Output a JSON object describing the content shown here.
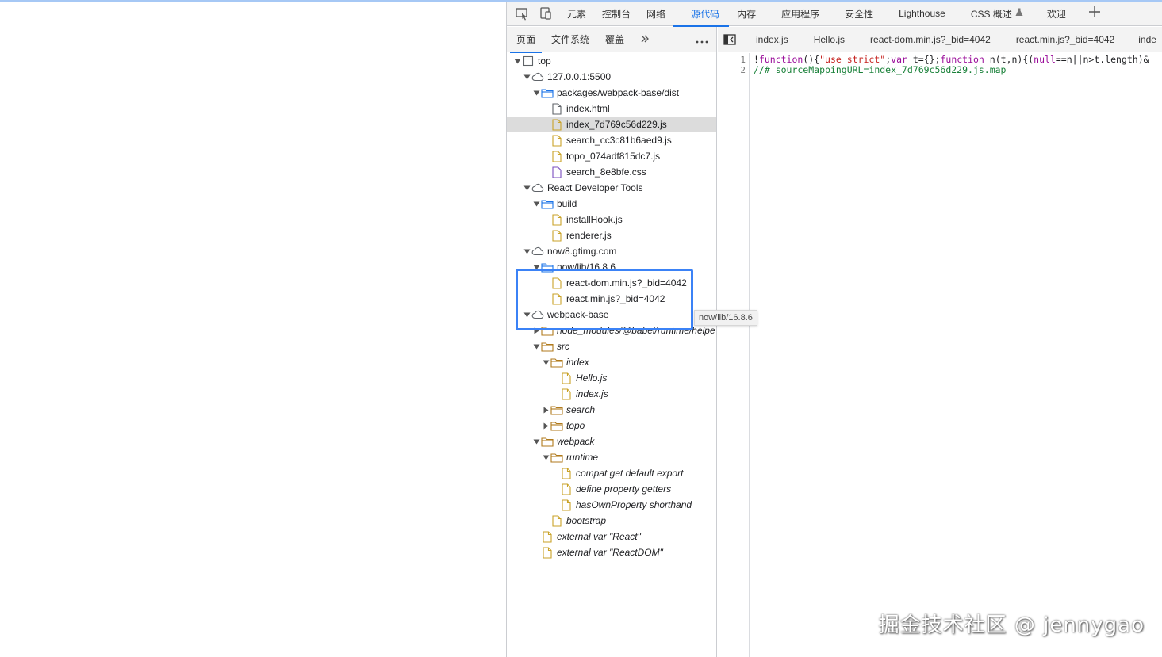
{
  "toolbar": {
    "tabs": [
      "元素",
      "控制台",
      "网络",
      "源代码",
      "内存",
      "应用程序",
      "安全性",
      "Lighthouse",
      "CSS 概述",
      "欢迎"
    ],
    "active_tab": "源代码"
  },
  "navigator": {
    "tabs": [
      "页面",
      "文件系统",
      "覆盖"
    ],
    "active_tab": "页面",
    "tree": [
      {
        "label": "top",
        "depth": 0,
        "icon": "frame-icon",
        "expanded": true
      },
      {
        "label": "127.0.0.1:5500",
        "depth": 1,
        "icon": "cloud-icon",
        "expanded": true
      },
      {
        "label": "packages/webpack-base/dist",
        "depth": 2,
        "icon": "folder-icon",
        "expanded": true
      },
      {
        "label": "index.html",
        "depth": 3,
        "icon": "document-icon"
      },
      {
        "label": "index_7d769c56d229.js",
        "depth": 3,
        "icon": "script-file-icon",
        "selected": true
      },
      {
        "label": "search_cc3c81b6aed9.js",
        "depth": 3,
        "icon": "script-file-icon"
      },
      {
        "label": "topo_074adf815dc7.js",
        "depth": 3,
        "icon": "script-file-icon"
      },
      {
        "label": "search_8e8bfe.css",
        "depth": 3,
        "icon": "stylesheet-file-icon"
      },
      {
        "label": "React Developer Tools",
        "depth": 1,
        "icon": "cloud-icon",
        "expanded": true
      },
      {
        "label": "build",
        "depth": 2,
        "icon": "folder-icon",
        "expanded": true
      },
      {
        "label": "installHook.js",
        "depth": 3,
        "icon": "script-file-icon"
      },
      {
        "label": "renderer.js",
        "depth": 3,
        "icon": "script-file-icon"
      },
      {
        "label": "now8.gtimg.com",
        "depth": 1,
        "icon": "cloud-icon",
        "expanded": true
      },
      {
        "label": "now/lib/16.8.6",
        "depth": 2,
        "icon": "folder-icon",
        "expanded": true
      },
      {
        "label": "react-dom.min.js?_bid=4042",
        "depth": 3,
        "icon": "script-file-icon"
      },
      {
        "label": "react.min.js?_bid=4042",
        "depth": 3,
        "icon": "script-file-icon"
      },
      {
        "label": "webpack-base",
        "depth": 1,
        "icon": "cloud-icon",
        "expanded": true
      },
      {
        "label": "node_modules/@babel/runtime/helpe",
        "depth": 2,
        "icon": "source-folder-icon",
        "expanded": false,
        "italic": true
      },
      {
        "label": "src",
        "depth": 2,
        "icon": "source-folder-icon",
        "expanded": true,
        "italic": true
      },
      {
        "label": "index",
        "depth": 3,
        "icon": "source-folder-icon",
        "expanded": true,
        "italic": true
      },
      {
        "label": "Hello.js",
        "depth": 4,
        "icon": "script-file-icon",
        "italic": true
      },
      {
        "label": "index.js",
        "depth": 4,
        "icon": "script-file-icon",
        "italic": true
      },
      {
        "label": "search",
        "depth": 3,
        "icon": "source-folder-icon",
        "expanded": false,
        "italic": true
      },
      {
        "label": "topo",
        "depth": 3,
        "icon": "source-folder-icon",
        "expanded": false,
        "italic": true
      },
      {
        "label": "webpack",
        "depth": 2,
        "icon": "source-folder-icon",
        "expanded": true,
        "italic": true
      },
      {
        "label": "runtime",
        "depth": 3,
        "icon": "source-folder-icon",
        "expanded": true,
        "italic": true
      },
      {
        "label": "compat get default export",
        "depth": 4,
        "icon": "script-file-icon",
        "italic": true
      },
      {
        "label": "define property getters",
        "depth": 4,
        "icon": "script-file-icon",
        "italic": true
      },
      {
        "label": "hasOwnProperty shorthand",
        "depth": 4,
        "icon": "script-file-icon",
        "italic": true
      },
      {
        "label": "bootstrap",
        "depth": 3,
        "icon": "script-file-icon",
        "italic": true
      },
      {
        "label": "external var \"React\"",
        "depth": 2,
        "icon": "script-file-icon",
        "italic": true
      },
      {
        "label": "external var \"ReactDOM\"",
        "depth": 2,
        "icon": "script-file-icon",
        "italic": true
      }
    ],
    "tooltip": "now/lib/16.8.6"
  },
  "editor": {
    "tabs": [
      "index.js",
      "Hello.js",
      "react-dom.min.js?_bid=4042",
      "react.min.js?_bid=4042",
      "inde"
    ],
    "active_tab": "inde",
    "line_numbers": [
      "1",
      "2"
    ],
    "code": {
      "l1_a": "!",
      "l1_function": "function",
      "l1_b": "(){",
      "l1_use_strict": "\"use strict\"",
      "l1_c": ";",
      "l1_var": "var",
      "l1_d": " t={};",
      "l1_function2": "function",
      "l1_e": " n(t,n){(",
      "l1_null": "null",
      "l1_f": "==n||n>t.length)&",
      "l2": "//# sourceMappingURL=index_7d769c56d229.js.map"
    }
  },
  "watermark": "掘金技术社区 @ jennygao",
  "colors": {
    "accent": "#1a73e8",
    "highlight_box": "#3b82f6",
    "folder": "#1a73e8",
    "script_file": "#c9a227"
  }
}
